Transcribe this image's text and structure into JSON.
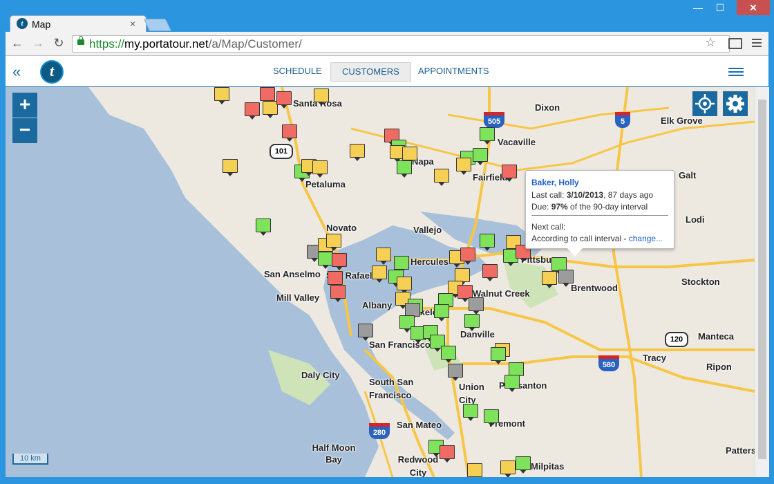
{
  "browser": {
    "tab_title": "Map",
    "tab_close": "×",
    "url_scheme": "https://",
    "url_host": "my.portatour.net",
    "url_path": "/a/Map/Customer/",
    "window_controls": {
      "minimize": "—",
      "maximize": "☐",
      "close": "✕"
    },
    "icons": {
      "back": "back-arrow-icon",
      "forward": "forward-arrow-icon",
      "reload": "reload-icon",
      "star": "bookmark-star-icon",
      "menu": "chrome-menu-icon"
    }
  },
  "app": {
    "logo_letter": "t",
    "nav_tabs": [
      "SCHEDULE",
      "CUSTOMERS",
      "APPOINTMENTS"
    ],
    "active_tab": "CUSTOMERS"
  },
  "map": {
    "zoom_in": "+",
    "zoom_out": "−",
    "scale": "10 km",
    "place_labels": [
      "Santa Rosa",
      "Dixon",
      "Elk Grove",
      "Vacaville",
      "Napa",
      "Fairfield",
      "Galt",
      "Petaluma",
      "Novato",
      "Vallejo",
      "Lodi",
      "Hercules",
      "Pittsburg",
      "San Anselmo",
      "San Rafael",
      "Brentwood",
      "Stockton",
      "Mill Valley",
      "Walnut Creek",
      "Albany",
      "Berkeley",
      "Danville",
      "San Francisco",
      "Manteca",
      "Daly City",
      "Tracy",
      "South San Francisco",
      "Pleasanton",
      "Ripon",
      "Union City",
      "San Mateo",
      "Fremont",
      "Half Moon Bay",
      "Redwood City",
      "Patterson",
      "Milpitas"
    ],
    "highway_shields": [
      "101",
      "505",
      "5",
      "120",
      "280",
      "580"
    ],
    "marker_legend": {
      "green": "#7ee35a",
      "yellow": "#f6cf55",
      "red": "#f06b63",
      "gray": "#9c9c9c"
    }
  },
  "popup": {
    "name": "Baker, Holly",
    "last_call_prefix": "Last call: ",
    "last_call_date": "3/10/2013",
    "last_call_suffix": ", 87 days ago",
    "due_prefix": "Due: ",
    "due_value": "97%",
    "due_suffix": " of the 90-day interval",
    "next_call_label": "Next call:",
    "next_call_text": "According to call interval - ",
    "change_link": "change..."
  }
}
